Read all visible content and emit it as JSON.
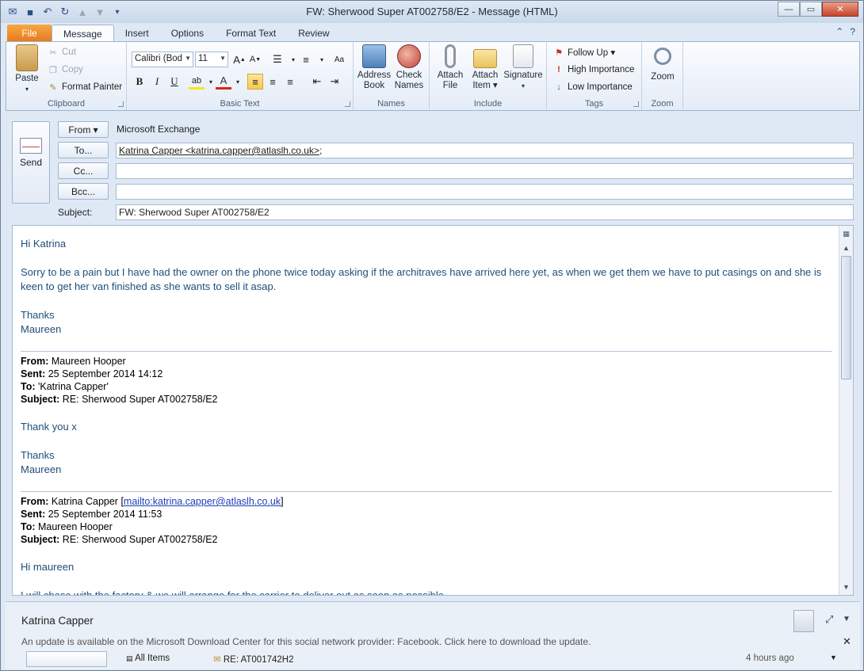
{
  "window": {
    "title": "FW: Sherwood Super AT002758/E2  -  Message (HTML)",
    "minimize": "—",
    "maximize": "▭",
    "close": "✕"
  },
  "tabs": [
    "File",
    "Message",
    "Insert",
    "Options",
    "Format Text",
    "Review"
  ],
  "ribbon": {
    "clipboard": {
      "label": "Clipboard",
      "paste": "Paste",
      "cut": "Cut",
      "copy": "Copy",
      "format_painter": "Format Painter"
    },
    "basic_text": {
      "label": "Basic Text",
      "font": "Calibri (Body)",
      "font_shown": "Calibri (Bod",
      "size": "11"
    },
    "names": {
      "label": "Names",
      "address_book": [
        "Address",
        "Book"
      ],
      "check_names": [
        "Check",
        "Names"
      ]
    },
    "include": {
      "label": "Include",
      "attach_file": [
        "Attach",
        "File"
      ],
      "attach_item": [
        "Attach",
        "Item ▾"
      ],
      "signature": "Signature"
    },
    "tags": {
      "label": "Tags",
      "follow_up": "Follow Up ▾",
      "high_importance": "High Importance",
      "low_importance": "Low Importance"
    },
    "zoom": {
      "label": "Zoom",
      "zoom": "Zoom"
    }
  },
  "header": {
    "send": "Send",
    "from_button": "From ▾",
    "from_value": "Microsoft Exchange",
    "to_button": "To...",
    "to_value": "Katrina Capper <katrina.capper@atlaslh.co.uk>",
    "to_sep": ";",
    "cc_button": "Cc...",
    "cc_value": "",
    "bcc_button": "Bcc...",
    "bcc_value": "",
    "subject_label": "Subject:",
    "subject_value": "FW: Sherwood Super AT002758/E2"
  },
  "body": {
    "greeting": "Hi Katrina",
    "paragraph": "Sorry to be a pain but I have had the owner on the phone twice today asking if the architraves have arrived here yet, as when we get them we have to put casings on and she is keen to get her van finished as she wants to sell it asap.",
    "thanks": "Thanks",
    "signoff": "Maureen",
    "msg1": {
      "from_label": "From:",
      "from": " Maureen Hooper",
      "sent_label": "Sent:",
      "sent": " 25 September 2014 14:12",
      "to_label": "To:",
      "to": " 'Katrina Capper'",
      "subject_label": "Subject:",
      "subject": " RE: Sherwood Super AT002758/E2",
      "text": "Thank you x",
      "thanks": "Thanks",
      "signoff": "Maureen"
    },
    "msg2": {
      "from_label": "From:",
      "from": " Katrina Capper [",
      "mailto": "mailto:katrina.capper@atlaslh.co.uk",
      "from_end": "]",
      "sent_label": "Sent:",
      "sent": " 25 September 2014 11:53",
      "to_label": "To:",
      "to": " Maureen Hooper",
      "subject_label": "Subject:",
      "subject": " RE: Sherwood Super AT002758/E2",
      "greeting": "Hi maureen",
      "text": "I will chase with the factory & we will arrange for the carrier to deliver out as soon as possible."
    }
  },
  "people_pane": {
    "name": "Katrina Capper",
    "update_notice": "An update is available on the Microsoft Download Center for this social network provider: Facebook. Click here to download the update.",
    "all_items": "All Items",
    "item_subject": "RE: AT001742H2",
    "item_time": "4 hours ago"
  },
  "colors": {
    "body_text": "#1f4e79",
    "file_tab": "#e6791b",
    "link": "#1f3fb8"
  }
}
